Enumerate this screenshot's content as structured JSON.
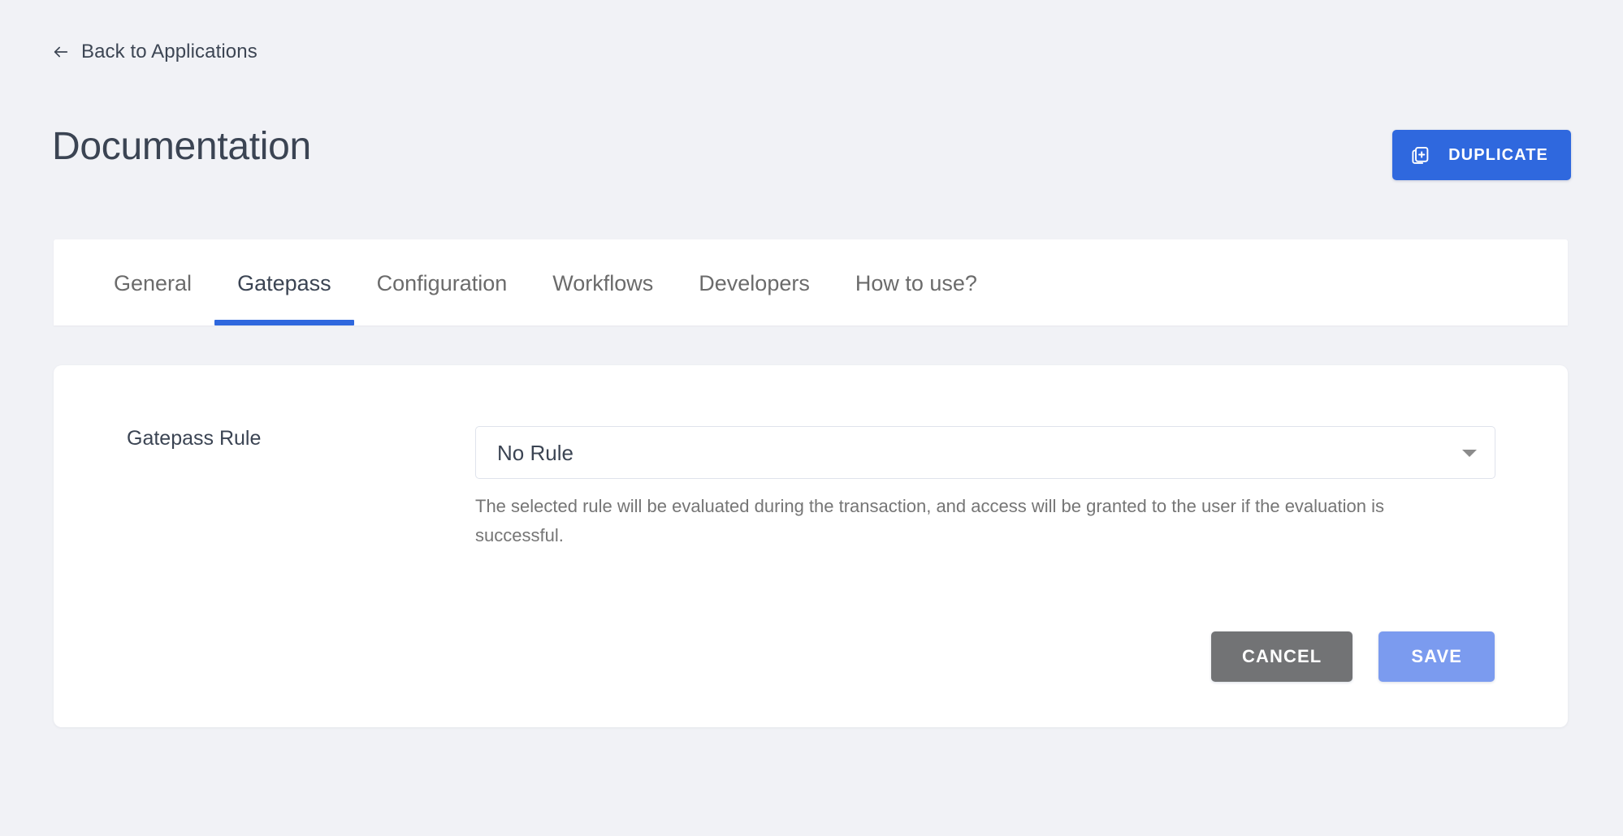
{
  "colors": {
    "background": "#f1f2f6",
    "card": "#ffffff",
    "primary_blue": "#2f68de",
    "save_blue": "#7b9bef",
    "cancel_gray": "#727375",
    "text_dark": "#3b4453",
    "text_muted": "#757575",
    "border": "#dfe3ec"
  },
  "back": {
    "label": "Back to Applications",
    "icon": "arrow-left-icon"
  },
  "header": {
    "title": "Documentation",
    "duplicate_button": {
      "label": "DUPLICATE",
      "icon": "duplicate-add-icon"
    }
  },
  "tabs": {
    "active": "Gatepass",
    "items": [
      {
        "label": "General",
        "active": false
      },
      {
        "label": "Gatepass",
        "active": true
      },
      {
        "label": "Configuration",
        "active": false
      },
      {
        "label": "Workflows",
        "active": false
      },
      {
        "label": "Developers",
        "active": false
      },
      {
        "label": "How to use?",
        "active": false
      }
    ]
  },
  "form": {
    "gatepass_rule": {
      "label": "Gatepass Rule",
      "selected_value": "No Rule",
      "caret_icon": "chevron-down-icon",
      "help_text": "The selected rule will be evaluated during the transaction, and access will be granted to the user if the evaluation is successful."
    },
    "actions": {
      "cancel_label": "CANCEL",
      "save_label": "SAVE"
    }
  }
}
